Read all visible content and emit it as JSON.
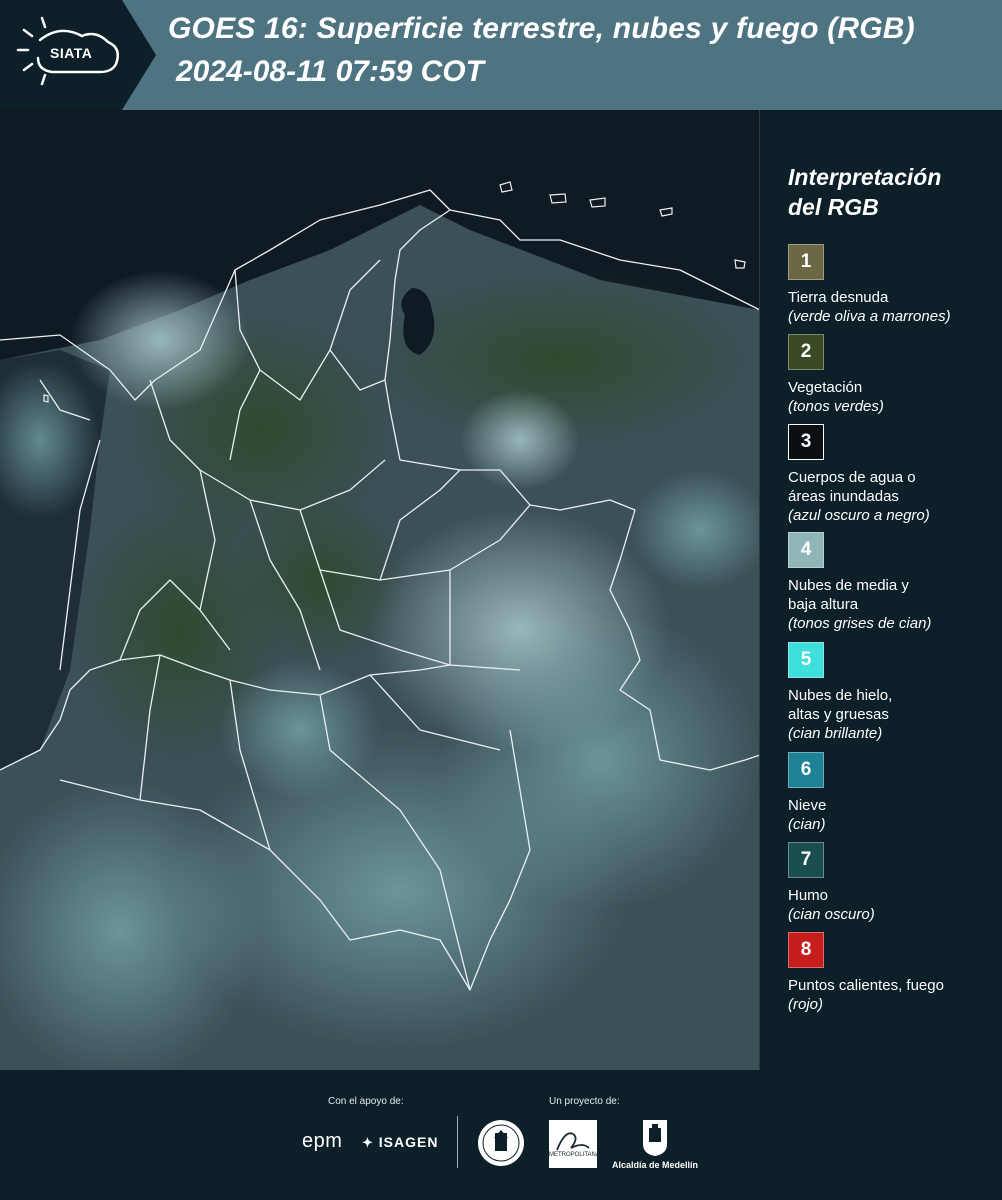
{
  "header": {
    "logo_text": "SIATA",
    "title_line1": "GOES 16: Superficie terrestre, nubes y fuego (RGB)",
    "title_line2": "2024-08-11 07:59 COT"
  },
  "legend": {
    "title_line1": "Interpretación",
    "title_line2": "del RGB",
    "items": [
      {
        "number": "1",
        "color": "#6c6845",
        "label": "Tierra desnuda",
        "note": "(verde oliva a marrones)"
      },
      {
        "number": "2",
        "color": "#3a4a24",
        "label": "Vegetación",
        "note": "(tonos verdes)"
      },
      {
        "number": "3",
        "color": "#0a0f12",
        "label": "Cuerpos de agua o áreas inundadas",
        "note": "(azul oscuro a negro)"
      },
      {
        "number": "4",
        "color": "#8fb5b6",
        "label": "Nubes de media y baja altura",
        "note": "(tonos grises de cian)"
      },
      {
        "number": "5",
        "color": "#3fe0dc",
        "label": "Nubes de hielo, altas y gruesas",
        "note": "(cian brillante)"
      },
      {
        "number": "6",
        "color": "#1e8296",
        "label": "Nieve",
        "note": "(cian)"
      },
      {
        "number": "7",
        "color": "#1b4e4e",
        "label": "Humo",
        "note": "(cian oscuro)"
      },
      {
        "number": "8",
        "color": "#c61d1d",
        "label": "Puntos calientes, fuego",
        "note": "(rojo)"
      }
    ]
  },
  "footer": {
    "support_caption": "Con el apoyo de:",
    "project_caption": "Un proyecto de:",
    "sponsor_epm": "epm",
    "sponsor_isagen": "ISAGEN",
    "metro_name": "METROPOLITANA",
    "alcaldia": "Alcaldía de Medellín"
  }
}
